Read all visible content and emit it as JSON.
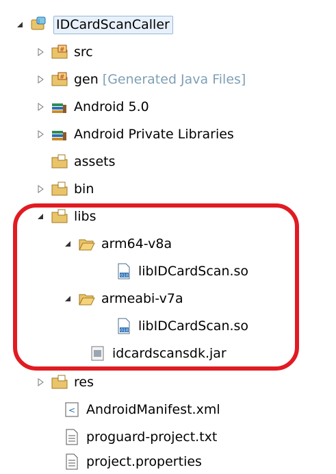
{
  "tree": {
    "root": {
      "label": "IDCardScanCaller"
    },
    "items": [
      {
        "label": "src"
      },
      {
        "label": "gen",
        "suffix": "[Generated Java Files]"
      },
      {
        "label": "Android 5.0"
      },
      {
        "label": "Android Private Libraries"
      },
      {
        "label": "assets"
      },
      {
        "label": "bin"
      },
      {
        "label": "libs"
      },
      {
        "label": "arm64-v8a"
      },
      {
        "label": "libIDCardScan.so"
      },
      {
        "label": "armeabi-v7a"
      },
      {
        "label": "libIDCardScan.so"
      },
      {
        "label": "idcardscansdk.jar"
      },
      {
        "label": "res"
      },
      {
        "label": "AndroidManifest.xml"
      },
      {
        "label": "proguard-project.txt"
      },
      {
        "label": "project.properties"
      }
    ]
  },
  "colors": {
    "highlight": "#e11b22",
    "folder": "#e9c46a",
    "library": "#2b6fb4",
    "suffix": "#7f9fb5"
  },
  "icons": {
    "expanded": "triangle-down-icon",
    "collapsed": "triangle-right-icon",
    "project": "android-project-icon",
    "package": "package-folder-icon",
    "folder": "folder-icon",
    "library": "library-icon",
    "binary": "binary-file-icon",
    "jar": "jar-icon",
    "xml": "xml-file-icon",
    "text": "text-file-icon"
  }
}
